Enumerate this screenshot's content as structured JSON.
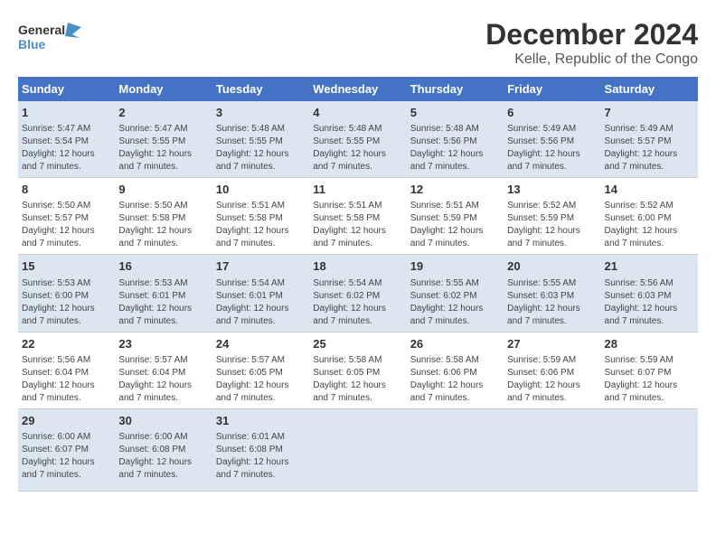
{
  "logo": {
    "line1": "General",
    "line2": "Blue"
  },
  "title": "December 2024",
  "subtitle": "Kelle, Republic of the Congo",
  "days_header": [
    "Sunday",
    "Monday",
    "Tuesday",
    "Wednesday",
    "Thursday",
    "Friday",
    "Saturday"
  ],
  "weeks": [
    [
      {
        "num": "1",
        "info": "Sunrise: 5:47 AM\nSunset: 5:54 PM\nDaylight: 12 hours\nand 7 minutes."
      },
      {
        "num": "2",
        "info": "Sunrise: 5:47 AM\nSunset: 5:55 PM\nDaylight: 12 hours\nand 7 minutes."
      },
      {
        "num": "3",
        "info": "Sunrise: 5:48 AM\nSunset: 5:55 PM\nDaylight: 12 hours\nand 7 minutes."
      },
      {
        "num": "4",
        "info": "Sunrise: 5:48 AM\nSunset: 5:55 PM\nDaylight: 12 hours\nand 7 minutes."
      },
      {
        "num": "5",
        "info": "Sunrise: 5:48 AM\nSunset: 5:56 PM\nDaylight: 12 hours\nand 7 minutes."
      },
      {
        "num": "6",
        "info": "Sunrise: 5:49 AM\nSunset: 5:56 PM\nDaylight: 12 hours\nand 7 minutes."
      },
      {
        "num": "7",
        "info": "Sunrise: 5:49 AM\nSunset: 5:57 PM\nDaylight: 12 hours\nand 7 minutes."
      }
    ],
    [
      {
        "num": "8",
        "info": "Sunrise: 5:50 AM\nSunset: 5:57 PM\nDaylight: 12 hours\nand 7 minutes."
      },
      {
        "num": "9",
        "info": "Sunrise: 5:50 AM\nSunset: 5:58 PM\nDaylight: 12 hours\nand 7 minutes."
      },
      {
        "num": "10",
        "info": "Sunrise: 5:51 AM\nSunset: 5:58 PM\nDaylight: 12 hours\nand 7 minutes."
      },
      {
        "num": "11",
        "info": "Sunrise: 5:51 AM\nSunset: 5:58 PM\nDaylight: 12 hours\nand 7 minutes."
      },
      {
        "num": "12",
        "info": "Sunrise: 5:51 AM\nSunset: 5:59 PM\nDaylight: 12 hours\nand 7 minutes."
      },
      {
        "num": "13",
        "info": "Sunrise: 5:52 AM\nSunset: 5:59 PM\nDaylight: 12 hours\nand 7 minutes."
      },
      {
        "num": "14",
        "info": "Sunrise: 5:52 AM\nSunset: 6:00 PM\nDaylight: 12 hours\nand 7 minutes."
      }
    ],
    [
      {
        "num": "15",
        "info": "Sunrise: 5:53 AM\nSunset: 6:00 PM\nDaylight: 12 hours\nand 7 minutes."
      },
      {
        "num": "16",
        "info": "Sunrise: 5:53 AM\nSunset: 6:01 PM\nDaylight: 12 hours\nand 7 minutes."
      },
      {
        "num": "17",
        "info": "Sunrise: 5:54 AM\nSunset: 6:01 PM\nDaylight: 12 hours\nand 7 minutes."
      },
      {
        "num": "18",
        "info": "Sunrise: 5:54 AM\nSunset: 6:02 PM\nDaylight: 12 hours\nand 7 minutes."
      },
      {
        "num": "19",
        "info": "Sunrise: 5:55 AM\nSunset: 6:02 PM\nDaylight: 12 hours\nand 7 minutes."
      },
      {
        "num": "20",
        "info": "Sunrise: 5:55 AM\nSunset: 6:03 PM\nDaylight: 12 hours\nand 7 minutes."
      },
      {
        "num": "21",
        "info": "Sunrise: 5:56 AM\nSunset: 6:03 PM\nDaylight: 12 hours\nand 7 minutes."
      }
    ],
    [
      {
        "num": "22",
        "info": "Sunrise: 5:56 AM\nSunset: 6:04 PM\nDaylight: 12 hours\nand 7 minutes."
      },
      {
        "num": "23",
        "info": "Sunrise: 5:57 AM\nSunset: 6:04 PM\nDaylight: 12 hours\nand 7 minutes."
      },
      {
        "num": "24",
        "info": "Sunrise: 5:57 AM\nSunset: 6:05 PM\nDaylight: 12 hours\nand 7 minutes."
      },
      {
        "num": "25",
        "info": "Sunrise: 5:58 AM\nSunset: 6:05 PM\nDaylight: 12 hours\nand 7 minutes."
      },
      {
        "num": "26",
        "info": "Sunrise: 5:58 AM\nSunset: 6:06 PM\nDaylight: 12 hours\nand 7 minutes."
      },
      {
        "num": "27",
        "info": "Sunrise: 5:59 AM\nSunset: 6:06 PM\nDaylight: 12 hours\nand 7 minutes."
      },
      {
        "num": "28",
        "info": "Sunrise: 5:59 AM\nSunset: 6:07 PM\nDaylight: 12 hours\nand 7 minutes."
      }
    ],
    [
      {
        "num": "29",
        "info": "Sunrise: 6:00 AM\nSunset: 6:07 PM\nDaylight: 12 hours\nand 7 minutes."
      },
      {
        "num": "30",
        "info": "Sunrise: 6:00 AM\nSunset: 6:08 PM\nDaylight: 12 hours\nand 7 minutes."
      },
      {
        "num": "31",
        "info": "Sunrise: 6:01 AM\nSunset: 6:08 PM\nDaylight: 12 hours\nand 7 minutes."
      },
      {
        "num": "",
        "info": ""
      },
      {
        "num": "",
        "info": ""
      },
      {
        "num": "",
        "info": ""
      },
      {
        "num": "",
        "info": ""
      }
    ]
  ]
}
